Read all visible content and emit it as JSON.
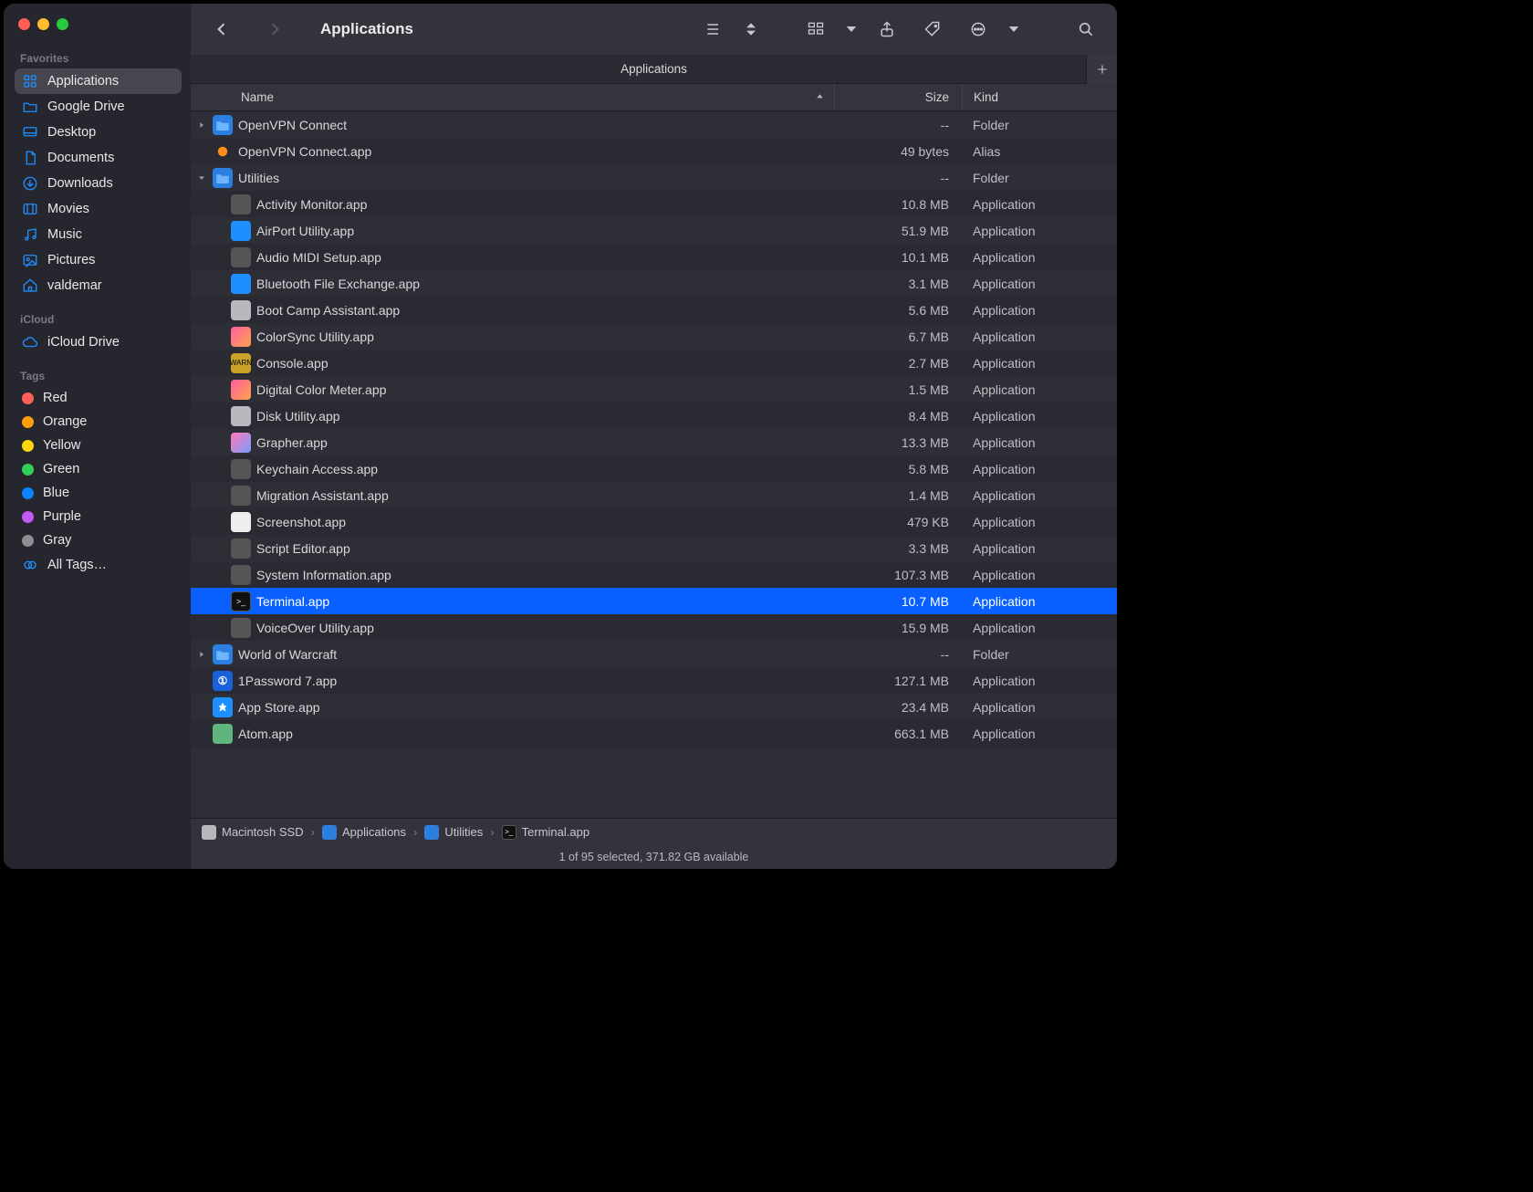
{
  "window_title": "Applications",
  "tab_title": "Applications",
  "sidebar": {
    "sections": [
      {
        "label": "Favorites",
        "items": [
          {
            "label": "Applications",
            "icon": "grid",
            "selected": true
          },
          {
            "label": "Google Drive",
            "icon": "folder"
          },
          {
            "label": "Desktop",
            "icon": "desktop"
          },
          {
            "label": "Documents",
            "icon": "doc"
          },
          {
            "label": "Downloads",
            "icon": "download"
          },
          {
            "label": "Movies",
            "icon": "movie"
          },
          {
            "label": "Music",
            "icon": "music"
          },
          {
            "label": "Pictures",
            "icon": "picture"
          },
          {
            "label": "valdemar",
            "icon": "house"
          }
        ]
      },
      {
        "label": "iCloud",
        "items": [
          {
            "label": "iCloud Drive",
            "icon": "cloud"
          }
        ]
      },
      {
        "label": "Tags",
        "items": [
          {
            "label": "Red",
            "tag": "#ff5f57"
          },
          {
            "label": "Orange",
            "tag": "#ff9f0a"
          },
          {
            "label": "Yellow",
            "tag": "#ffd60a"
          },
          {
            "label": "Green",
            "tag": "#30d158"
          },
          {
            "label": "Blue",
            "tag": "#0a84ff"
          },
          {
            "label": "Purple",
            "tag": "#bf5af2"
          },
          {
            "label": "Gray",
            "tag": "#8e8e93"
          },
          {
            "label": "All Tags…",
            "icon": "alltags"
          }
        ]
      }
    ]
  },
  "columns": {
    "name": "Name",
    "size": "Size",
    "kind": "Kind"
  },
  "sort_column": "name",
  "sort_ascending": true,
  "rows": [
    {
      "depth": 0,
      "disclosure": "closed",
      "name": "OpenVPN Connect",
      "size": "--",
      "kind": "Folder",
      "icon": "folder"
    },
    {
      "depth": 0,
      "disclosure": "none",
      "name": "OpenVPN Connect.app",
      "size": "49 bytes",
      "kind": "Alias",
      "icon": "ovpn"
    },
    {
      "depth": 0,
      "disclosure": "open",
      "name": "Utilities",
      "size": "--",
      "kind": "Folder",
      "icon": "folder"
    },
    {
      "depth": 1,
      "disclosure": "none",
      "name": "Activity Monitor.app",
      "size": "10.8 MB",
      "kind": "Application",
      "icon": "app-generic"
    },
    {
      "depth": 1,
      "disclosure": "none",
      "name": "AirPort Utility.app",
      "size": "51.9 MB",
      "kind": "Application",
      "icon": "bt"
    },
    {
      "depth": 1,
      "disclosure": "none",
      "name": "Audio MIDI Setup.app",
      "size": "10.1 MB",
      "kind": "Application",
      "icon": "app-generic"
    },
    {
      "depth": 1,
      "disclosure": "none",
      "name": "Bluetooth File Exchange.app",
      "size": "3.1 MB",
      "kind": "Application",
      "icon": "bt"
    },
    {
      "depth": 1,
      "disclosure": "none",
      "name": "Boot Camp Assistant.app",
      "size": "5.6 MB",
      "kind": "Application",
      "icon": "disk"
    },
    {
      "depth": 1,
      "disclosure": "none",
      "name": "ColorSync Utility.app",
      "size": "6.7 MB",
      "kind": "Application",
      "icon": "cs"
    },
    {
      "depth": 1,
      "disclosure": "none",
      "name": "Console.app",
      "size": "2.7 MB",
      "kind": "Application",
      "icon": "console"
    },
    {
      "depth": 1,
      "disclosure": "none",
      "name": "Digital Color Meter.app",
      "size": "1.5 MB",
      "kind": "Application",
      "icon": "cs"
    },
    {
      "depth": 1,
      "disclosure": "none",
      "name": "Disk Utility.app",
      "size": "8.4 MB",
      "kind": "Application",
      "icon": "disk"
    },
    {
      "depth": 1,
      "disclosure": "none",
      "name": "Grapher.app",
      "size": "13.3 MB",
      "kind": "Application",
      "icon": "grapher"
    },
    {
      "depth": 1,
      "disclosure": "none",
      "name": "Keychain Access.app",
      "size": "5.8 MB",
      "kind": "Application",
      "icon": "app-generic"
    },
    {
      "depth": 1,
      "disclosure": "none",
      "name": "Migration Assistant.app",
      "size": "1.4 MB",
      "kind": "Application",
      "icon": "app-generic"
    },
    {
      "depth": 1,
      "disclosure": "none",
      "name": "Screenshot.app",
      "size": "479 KB",
      "kind": "Application",
      "icon": "screenshot"
    },
    {
      "depth": 1,
      "disclosure": "none",
      "name": "Script Editor.app",
      "size": "3.3 MB",
      "kind": "Application",
      "icon": "app-generic"
    },
    {
      "depth": 1,
      "disclosure": "none",
      "name": "System Information.app",
      "size": "107.3 MB",
      "kind": "Application",
      "icon": "app-generic"
    },
    {
      "depth": 1,
      "disclosure": "none",
      "name": "Terminal.app",
      "size": "10.7 MB",
      "kind": "Application",
      "icon": "term",
      "selected": true
    },
    {
      "depth": 1,
      "disclosure": "none",
      "name": "VoiceOver Utility.app",
      "size": "15.9 MB",
      "kind": "Application",
      "icon": "app-generic"
    },
    {
      "depth": 0,
      "disclosure": "closed",
      "name": "World of Warcraft",
      "size": "--",
      "kind": "Folder",
      "icon": "folder"
    },
    {
      "depth": 0,
      "disclosure": "none",
      "name": "1Password 7.app",
      "size": "127.1 MB",
      "kind": "Application",
      "icon": "onep"
    },
    {
      "depth": 0,
      "disclosure": "none",
      "name": "App Store.app",
      "size": "23.4 MB",
      "kind": "Application",
      "icon": "appstore"
    },
    {
      "depth": 0,
      "disclosure": "none",
      "name": "Atom.app",
      "size": "663.1 MB",
      "kind": "Application",
      "icon": "atom"
    }
  ],
  "pathbar": [
    {
      "label": "Macintosh SSD",
      "icon": "disk"
    },
    {
      "label": "Applications",
      "icon": "folder"
    },
    {
      "label": "Utilities",
      "icon": "folder"
    },
    {
      "label": "Terminal.app",
      "icon": "term"
    }
  ],
  "status_text": "1 of 95 selected, 371.82 GB available"
}
